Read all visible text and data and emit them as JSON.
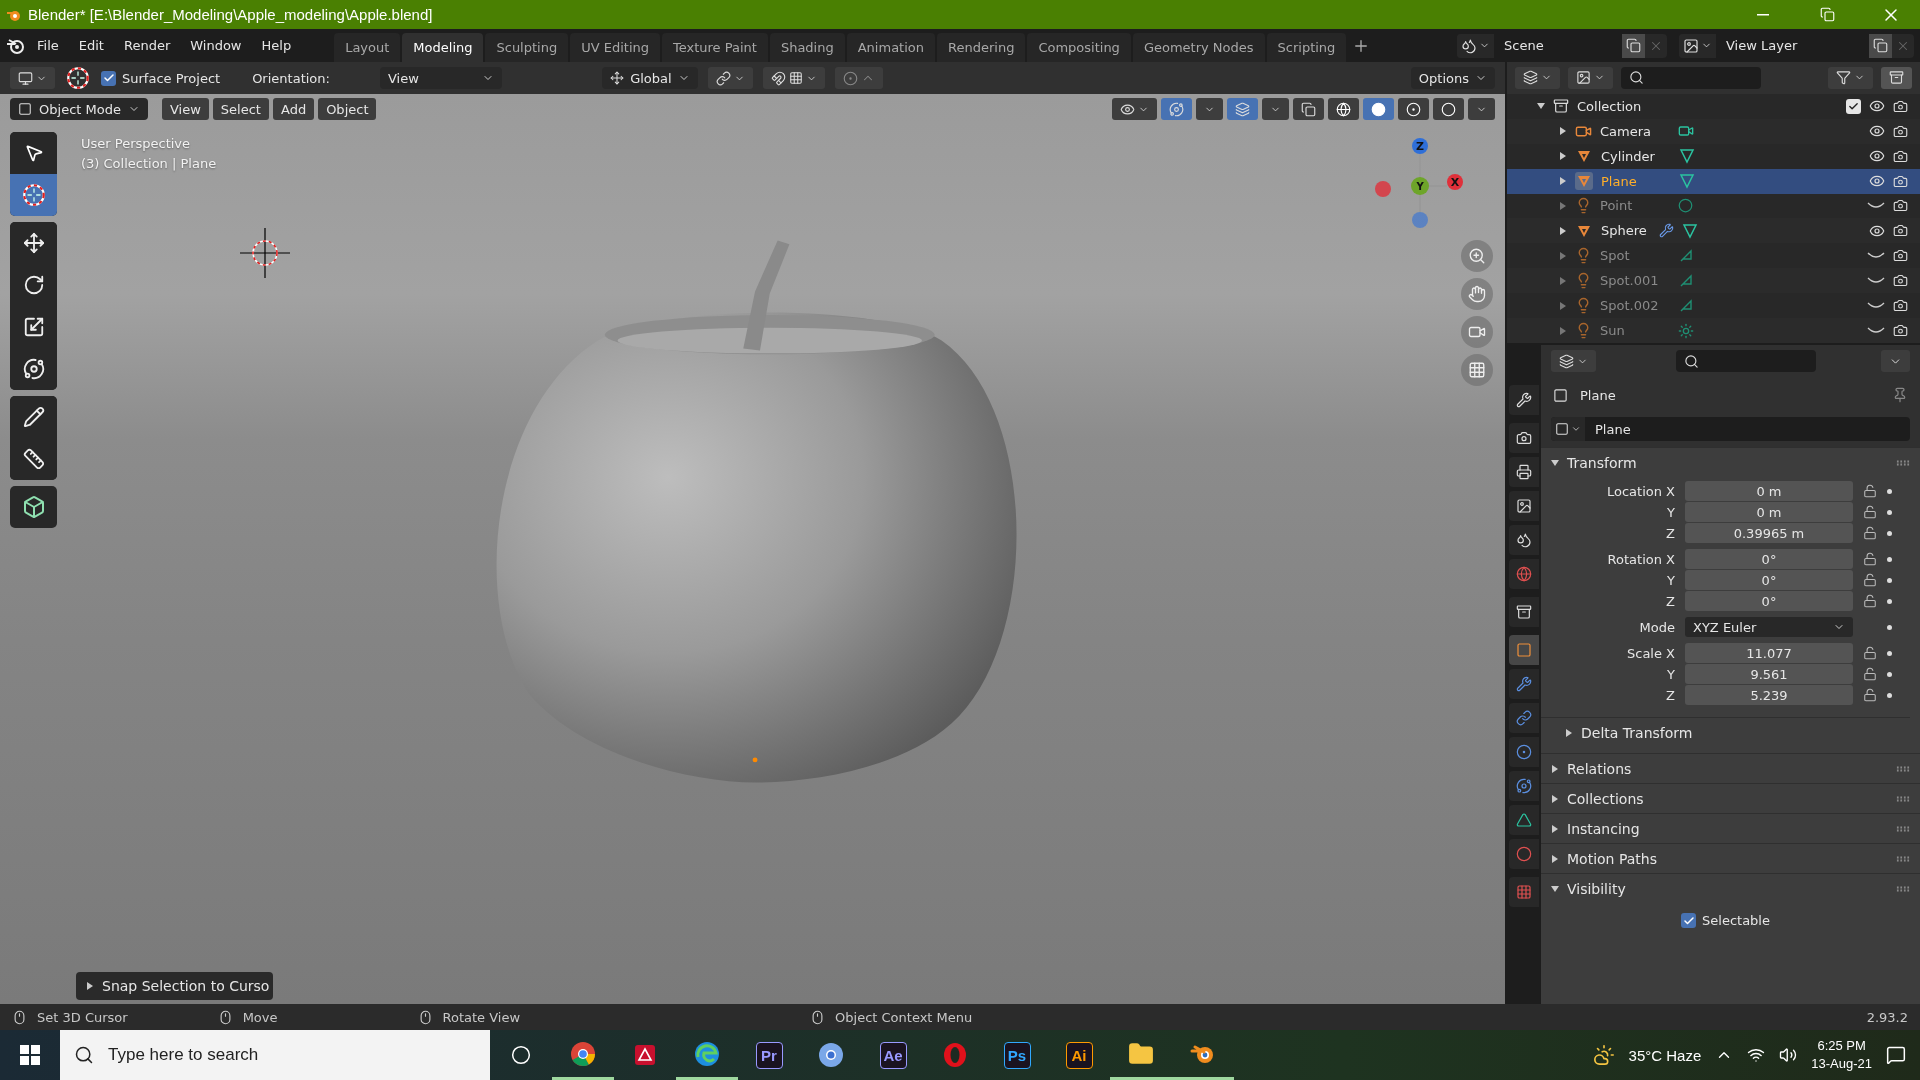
{
  "window": {
    "title": "Blender* [E:\\Blender_Modeling\\Apple_modeling\\Apple.blend]"
  },
  "menu": [
    "File",
    "Edit",
    "Render",
    "Window",
    "Help"
  ],
  "workspaces": [
    {
      "label": "Layout",
      "selected": false
    },
    {
      "label": "Modeling",
      "selected": true
    },
    {
      "label": "Sculpting",
      "selected": false
    },
    {
      "label": "UV Editing",
      "selected": false
    },
    {
      "label": "Texture Paint",
      "selected": false
    },
    {
      "label": "Shading",
      "selected": false
    },
    {
      "label": "Animation",
      "selected": false
    },
    {
      "label": "Rendering",
      "selected": false
    },
    {
      "label": "Compositing",
      "selected": false
    },
    {
      "label": "Geometry Nodes",
      "selected": false
    },
    {
      "label": "Scripting",
      "selected": false
    }
  ],
  "scene": "Scene",
  "view_layer": "View Layer",
  "tool_header": {
    "surface_project": {
      "label": "Surface Project",
      "checked": true
    },
    "orientation_label": "Orientation:",
    "orientation": "View",
    "transform": "Global",
    "options": "Options"
  },
  "viewport_header": {
    "mode": "Object Mode",
    "menus": [
      "View",
      "Select",
      "Add",
      "Object"
    ],
    "gizmos_on": true,
    "overlays_on": true,
    "xray_on": false,
    "shading": [
      {
        "selected": false
      },
      {
        "selected": true
      },
      {
        "selected": false
      },
      {
        "selected": false
      }
    ]
  },
  "viewport": {
    "perspective": "User Perspective",
    "context": "(3) Collection | Plane",
    "last_operator": "Snap Selection to Curso",
    "gizmo": [
      {
        "label": "Z",
        "color": "#2f6fd8"
      },
      {
        "label": "Y",
        "color": "#6ea52a"
      },
      {
        "label": "X",
        "color": "#e0303a"
      }
    ]
  },
  "toolbar": [
    [
      {
        "selected": false
      },
      {
        "selected": true
      }
    ],
    [
      {
        "selected": false
      },
      {
        "selected": false
      },
      {
        "selected": false
      },
      {
        "selected": false
      }
    ],
    [
      {
        "selected": false
      },
      {
        "selected": false
      }
    ],
    [
      {
        "selected": false
      }
    ]
  ],
  "outliner": {
    "collection": {
      "name": "Collection",
      "checked": true,
      "expanded": true,
      "children": [
        {
          "name": "Camera",
          "kind": "camera",
          "selected": false,
          "visible": true,
          "modifier": false
        },
        {
          "name": "Cylinder",
          "kind": "mesh",
          "selected": false,
          "visible": true,
          "modifier": false
        },
        {
          "name": "Plane",
          "kind": "mesh",
          "selected": true,
          "visible": true,
          "modifier": false
        },
        {
          "name": "Point",
          "kind": "point_light",
          "selected": false,
          "visible": false,
          "modifier": false
        },
        {
          "name": "Sphere",
          "kind": "mesh",
          "selected": false,
          "visible": true,
          "modifier": true
        },
        {
          "name": "Spot",
          "kind": "spot_light",
          "selected": false,
          "visible": false,
          "modifier": false
        },
        {
          "name": "Spot.001",
          "kind": "spot_light",
          "selected": false,
          "visible": false,
          "modifier": false
        },
        {
          "name": "Spot.002",
          "kind": "spot_light",
          "selected": false,
          "visible": false,
          "modifier": false
        },
        {
          "name": "Sun",
          "kind": "sun_light",
          "selected": false,
          "visible": false,
          "modifier": false
        }
      ]
    }
  },
  "properties": {
    "tabs": [
      [
        {
          "selected": false
        }
      ],
      [
        {
          "selected": false
        },
        {
          "selected": false
        },
        {
          "selected": false
        },
        {
          "selected": false
        },
        {
          "selected": false
        }
      ],
      [
        {
          "selected": false
        }
      ],
      [
        {
          "selected": true
        },
        {
          "selected": false
        },
        {
          "selected": false
        },
        {
          "selected": false
        },
        {
          "selected": false
        },
        {
          "selected": false
        },
        {
          "selected": false
        }
      ],
      [
        {
          "selected": false
        }
      ]
    ],
    "object": "Plane",
    "name_field": "Plane",
    "transform": {
      "title": "Transform",
      "expanded": true,
      "groups": [
        [
          {
            "kind": "number",
            "label": "Location X",
            "value": "0 m"
          },
          {
            "kind": "number",
            "label": "Y",
            "value": "0 m"
          },
          {
            "kind": "number",
            "label": "Z",
            "value": "0.39965 m"
          }
        ],
        [
          {
            "kind": "number",
            "label": "Rotation X",
            "value": "0°"
          },
          {
            "kind": "number",
            "label": "Y",
            "value": "0°"
          },
          {
            "kind": "number",
            "label": "Z",
            "value": "0°"
          }
        ],
        [
          {
            "kind": "dropdown",
            "label": "Mode",
            "value": "XYZ Euler"
          }
        ],
        [
          {
            "kind": "number",
            "label": "Scale X",
            "value": "11.077"
          },
          {
            "kind": "number",
            "label": "Y",
            "value": "9.561"
          },
          {
            "kind": "number",
            "label": "Z",
            "value": "5.239"
          }
        ]
      ],
      "subpanel": {
        "title": "Delta Transform",
        "expanded": false
      }
    },
    "panels": [
      {
        "title": "Relations",
        "expanded": false
      },
      {
        "title": "Collections",
        "expanded": false
      },
      {
        "title": "Instancing",
        "expanded": false
      },
      {
        "title": "Motion Paths",
        "expanded": false
      },
      {
        "title": "Visibility",
        "expanded": true
      }
    ],
    "selectable": {
      "label": "Selectable",
      "checked": true
    }
  },
  "status_bar": {
    "items": [
      "Set 3D Cursor",
      "Move",
      "Rotate View",
      "Object Context Menu"
    ],
    "version": "2.93.2"
  },
  "taskbar": {
    "search_placeholder": "Type here to search",
    "apps": [
      {
        "kind": "chrome",
        "running": true
      },
      {
        "kind": "acrobat",
        "running": false
      },
      {
        "kind": "edge",
        "running": true
      },
      {
        "kind": "adobe",
        "label": "Pr",
        "color": "#9999ff",
        "running": false
      },
      {
        "kind": "chromium",
        "running": false
      },
      {
        "kind": "adobe",
        "label": "Ae",
        "color": "#9999ff",
        "running": false
      },
      {
        "kind": "opera",
        "running": false
      },
      {
        "kind": "adobe",
        "label": "Ps",
        "color": "#31a8ff",
        "running": false
      },
      {
        "kind": "adobe",
        "label": "Ai",
        "color": "#ff9a00",
        "running": false
      },
      {
        "kind": "explorer",
        "running": true
      },
      {
        "kind": "blender",
        "running": true
      }
    ],
    "weather": "35°C  Haze",
    "time": "6:25 PM",
    "date": "13-Aug-21"
  }
}
